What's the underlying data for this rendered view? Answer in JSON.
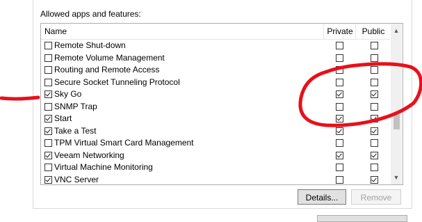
{
  "group_title": "Allowed apps and features:",
  "columns": {
    "name": "Name",
    "private": "Private",
    "public": "Public"
  },
  "rows": [
    {
      "name": "Remote Shut-down",
      "enabled": false,
      "private": false,
      "public": false
    },
    {
      "name": "Remote Volume Management",
      "enabled": false,
      "private": false,
      "public": false
    },
    {
      "name": "Routing and Remote Access",
      "enabled": false,
      "private": false,
      "public": false
    },
    {
      "name": "Secure Socket Tunneling Protocol",
      "enabled": false,
      "private": false,
      "public": false
    },
    {
      "name": "Sky Go",
      "enabled": true,
      "private": true,
      "public": true
    },
    {
      "name": "SNMP Trap",
      "enabled": false,
      "private": false,
      "public": false
    },
    {
      "name": "Start",
      "enabled": true,
      "private": true,
      "public": true
    },
    {
      "name": "Take a Test",
      "enabled": true,
      "private": true,
      "public": true
    },
    {
      "name": "TPM Virtual Smart Card Management",
      "enabled": false,
      "private": false,
      "public": false
    },
    {
      "name": "Veeam Networking",
      "enabled": true,
      "private": true,
      "public": true
    },
    {
      "name": "Virtual Machine Monitoring",
      "enabled": false,
      "private": false,
      "public": false
    },
    {
      "name": "VNC Server",
      "enabled": true,
      "private": false,
      "public": true
    }
  ],
  "buttons": {
    "details": "Details...",
    "remove": "Remove"
  },
  "scroll": {
    "up_icon": "chevron-up-icon",
    "down_icon": "chevron-down-icon"
  },
  "annotation_color": "#e8101a"
}
